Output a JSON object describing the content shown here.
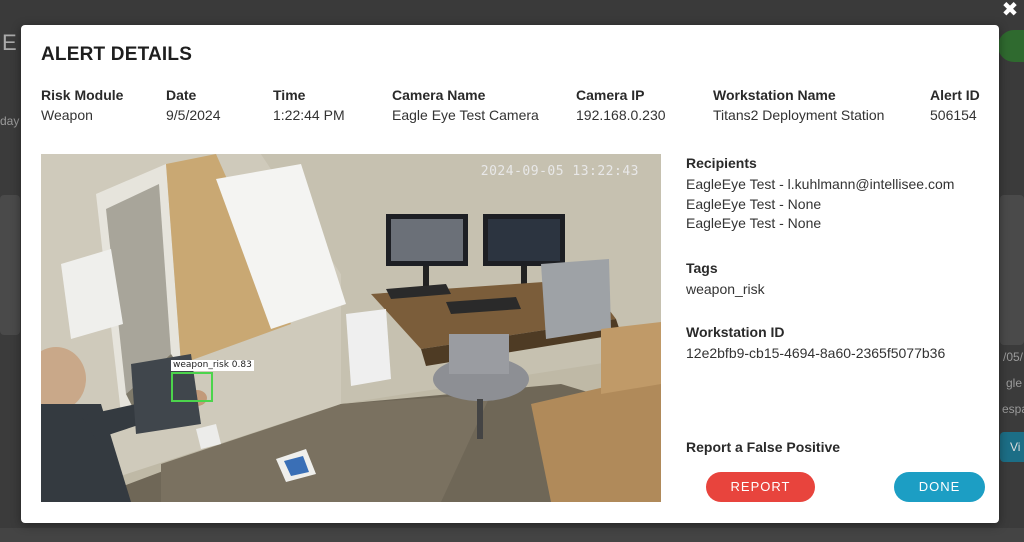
{
  "modal": {
    "title": "ALERT DETAILS",
    "close_glyph": "✖"
  },
  "meta": {
    "risk_module": {
      "label": "Risk Module",
      "value": "Weapon"
    },
    "date": {
      "label": "Date",
      "value": "9/5/2024"
    },
    "time": {
      "label": "Time",
      "value": "1:22:44 PM"
    },
    "camera_name": {
      "label": "Camera Name",
      "value": "Eagle Eye Test Camera"
    },
    "camera_ip": {
      "label": "Camera IP",
      "value": "192.168.0.230"
    },
    "workstation_name": {
      "label": "Workstation Name",
      "value": "Titans2 Deployment Station"
    },
    "alert_id": {
      "label": "Alert ID",
      "value": "506154"
    }
  },
  "camera": {
    "timestamp": "2024-09-05 13:22:43",
    "detection_label": "weapon_risk  0.83"
  },
  "recipients": {
    "title": "Recipients",
    "items": [
      "EagleEye Test - l.kuhlmann@intellisee.com",
      "EagleEye Test - None",
      "EagleEye Test - None"
    ]
  },
  "tags": {
    "title": "Tags",
    "items": [
      "weapon_risk"
    ]
  },
  "workstation_id": {
    "title": "Workstation ID",
    "value": "12e2bfb9-cb15-4694-8a60-2365f5077b36"
  },
  "false_positive_label": "Report a False Positive",
  "buttons": {
    "report": "REPORT",
    "done": "DONE"
  },
  "background": {
    "partial_e": "E",
    "partial_day": "day",
    "partial_date": "/05/",
    "partial_gle": "gle",
    "partial_espa": "espa",
    "partial_vi": "Vi"
  },
  "colors": {
    "report_button": "#e8443d",
    "done_button": "#1c9ec4",
    "detection_box": "#4cd44c"
  }
}
